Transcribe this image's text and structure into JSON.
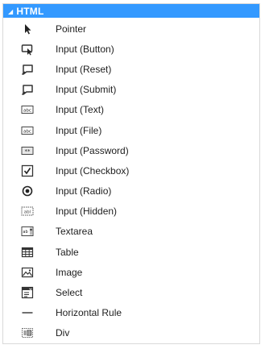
{
  "toolbox": {
    "section_title": "HTML",
    "items": [
      {
        "label": "Pointer",
        "icon": "pointer-icon"
      },
      {
        "label": "Input (Button)",
        "icon": "input-button-icon"
      },
      {
        "label": "Input (Reset)",
        "icon": "input-reset-icon"
      },
      {
        "label": "Input (Submit)",
        "icon": "input-submit-icon"
      },
      {
        "label": "Input (Text)",
        "icon": "input-text-icon"
      },
      {
        "label": "Input (File)",
        "icon": "input-file-icon"
      },
      {
        "label": "Input (Password)",
        "icon": "input-password-icon"
      },
      {
        "label": "Input (Checkbox)",
        "icon": "input-checkbox-icon"
      },
      {
        "label": "Input (Radio)",
        "icon": "input-radio-icon"
      },
      {
        "label": "Input (Hidden)",
        "icon": "input-hidden-icon"
      },
      {
        "label": "Textarea",
        "icon": "textarea-icon"
      },
      {
        "label": "Table",
        "icon": "table-icon"
      },
      {
        "label": "Image",
        "icon": "image-icon"
      },
      {
        "label": "Select",
        "icon": "select-icon"
      },
      {
        "label": "Horizontal Rule",
        "icon": "horizontal-rule-icon"
      },
      {
        "label": "Div",
        "icon": "div-icon"
      }
    ]
  },
  "colors": {
    "header_background": "#3399ff",
    "header_text": "#ffffff",
    "icon_stroke": "#333333",
    "border": "#d9d9d9"
  }
}
